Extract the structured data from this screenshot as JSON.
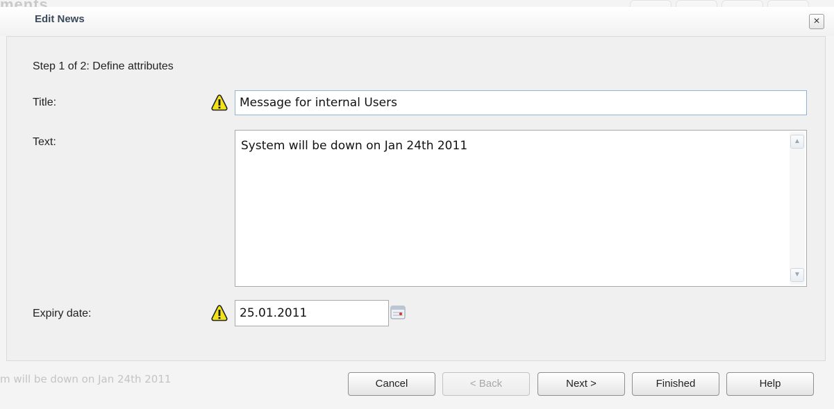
{
  "background": {
    "fragment_top": "ments",
    "fragment_bottom": "m will be down on Jan 24th 2011",
    "toolbar_icons": [
      "doc-icon",
      "edit-icon",
      "doc-icon",
      "export-icon"
    ]
  },
  "dialog": {
    "title": "Edit News",
    "close_label": "×",
    "step": "Step 1 of 2: Define attributes",
    "fields": {
      "title": {
        "label": "Title:",
        "value": "Message for internal Users",
        "icon": "warning-icon"
      },
      "text": {
        "label": "Text:",
        "value": "System will be down on Jan 24th 2011"
      },
      "expiry": {
        "label": "Expiry date:",
        "value": "25.01.2011",
        "icon": "warning-icon"
      }
    },
    "buttons": {
      "cancel": "Cancel",
      "back": "< Back",
      "next": "Next >",
      "finished": "Finished",
      "help": "Help"
    }
  },
  "colors": {
    "warning": "#f2e21a",
    "input_focus_border": "#8fb3d6"
  }
}
